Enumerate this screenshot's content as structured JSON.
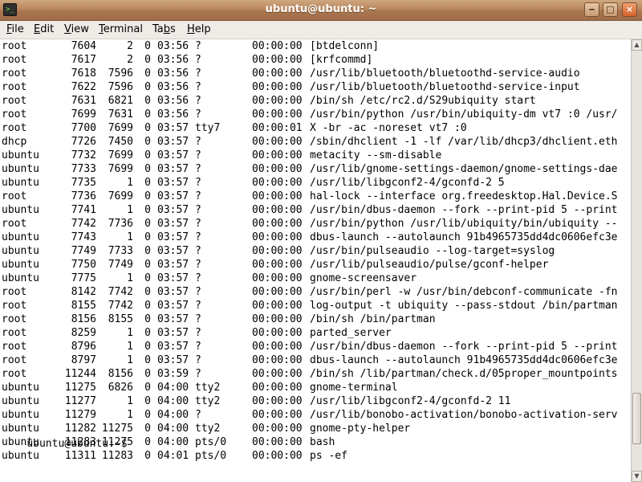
{
  "window": {
    "title": "ubuntu@ubuntu: ~",
    "buttons": {
      "minimize": "‒",
      "maximize": "□",
      "close": "×"
    }
  },
  "menu": [
    {
      "label": "File",
      "mnemonic": "F",
      "rest": "ile"
    },
    {
      "label": "Edit",
      "mnemonic": "E",
      "rest": "dit"
    },
    {
      "label": "View",
      "mnemonic": "V",
      "rest": "iew"
    },
    {
      "label": "Terminal",
      "mnemonic": "T",
      "rest": "erminal"
    },
    {
      "label": "Tabs",
      "mnemonic": "b",
      "pre": "Ta",
      "rest": "s"
    },
    {
      "label": "Help",
      "mnemonic": "H",
      "rest": "elp"
    }
  ],
  "terminal": {
    "rows": [
      {
        "user": "root",
        "pid": "7604",
        "ppid": "2",
        "c": "0",
        "stime": "03:56",
        "tty": "?",
        "time": "00:00:00",
        "cmd": "[btdelconn]"
      },
      {
        "user": "root",
        "pid": "7617",
        "ppid": "2",
        "c": "0",
        "stime": "03:56",
        "tty": "?",
        "time": "00:00:00",
        "cmd": "[krfcommd]"
      },
      {
        "user": "root",
        "pid": "7618",
        "ppid": "7596",
        "c": "0",
        "stime": "03:56",
        "tty": "?",
        "time": "00:00:00",
        "cmd": "/usr/lib/bluetooth/bluetoothd-service-audio"
      },
      {
        "user": "root",
        "pid": "7622",
        "ppid": "7596",
        "c": "0",
        "stime": "03:56",
        "tty": "?",
        "time": "00:00:00",
        "cmd": "/usr/lib/bluetooth/bluetoothd-service-input"
      },
      {
        "user": "root",
        "pid": "7631",
        "ppid": "6821",
        "c": "0",
        "stime": "03:56",
        "tty": "?",
        "time": "00:00:00",
        "cmd": "/bin/sh /etc/rc2.d/S29ubiquity start"
      },
      {
        "user": "root",
        "pid": "7699",
        "ppid": "7631",
        "c": "0",
        "stime": "03:56",
        "tty": "?",
        "time": "00:00:00",
        "cmd": "/usr/bin/python /usr/bin/ubiquity-dm vt7 :0 /usr/"
      },
      {
        "user": "root",
        "pid": "7700",
        "ppid": "7699",
        "c": "0",
        "stime": "03:57",
        "tty": "tty7",
        "time": "00:00:01",
        "cmd": "X -br -ac -noreset vt7 :0"
      },
      {
        "user": "dhcp",
        "pid": "7726",
        "ppid": "7450",
        "c": "0",
        "stime": "03:57",
        "tty": "?",
        "time": "00:00:00",
        "cmd": "/sbin/dhclient -1 -lf /var/lib/dhcp3/dhclient.eth"
      },
      {
        "user": "ubuntu",
        "pid": "7732",
        "ppid": "7699",
        "c": "0",
        "stime": "03:57",
        "tty": "?",
        "time": "00:00:00",
        "cmd": "metacity --sm-disable"
      },
      {
        "user": "ubuntu",
        "pid": "7733",
        "ppid": "7699",
        "c": "0",
        "stime": "03:57",
        "tty": "?",
        "time": "00:00:00",
        "cmd": "/usr/lib/gnome-settings-daemon/gnome-settings-dae"
      },
      {
        "user": "ubuntu",
        "pid": "7735",
        "ppid": "1",
        "c": "0",
        "stime": "03:57",
        "tty": "?",
        "time": "00:00:00",
        "cmd": "/usr/lib/libgconf2-4/gconfd-2 5"
      },
      {
        "user": "root",
        "pid": "7736",
        "ppid": "7699",
        "c": "0",
        "stime": "03:57",
        "tty": "?",
        "time": "00:00:00",
        "cmd": "hal-lock --interface org.freedesktop.Hal.Device.S"
      },
      {
        "user": "ubuntu",
        "pid": "7741",
        "ppid": "1",
        "c": "0",
        "stime": "03:57",
        "tty": "?",
        "time": "00:00:00",
        "cmd": "/usr/bin/dbus-daemon --fork --print-pid 5 --print"
      },
      {
        "user": "root",
        "pid": "7742",
        "ppid": "7736",
        "c": "0",
        "stime": "03:57",
        "tty": "?",
        "time": "00:00:00",
        "cmd": "/usr/bin/python /usr/lib/ubiquity/bin/ubiquity --"
      },
      {
        "user": "ubuntu",
        "pid": "7743",
        "ppid": "1",
        "c": "0",
        "stime": "03:57",
        "tty": "?",
        "time": "00:00:00",
        "cmd": "dbus-launch --autolaunch 91b4965735dd4dc0606efc3e"
      },
      {
        "user": "ubuntu",
        "pid": "7749",
        "ppid": "7733",
        "c": "0",
        "stime": "03:57",
        "tty": "?",
        "time": "00:00:00",
        "cmd": "/usr/bin/pulseaudio --log-target=syslog"
      },
      {
        "user": "ubuntu",
        "pid": "7750",
        "ppid": "7749",
        "c": "0",
        "stime": "03:57",
        "tty": "?",
        "time": "00:00:00",
        "cmd": "/usr/lib/pulseaudio/pulse/gconf-helper"
      },
      {
        "user": "ubuntu",
        "pid": "7775",
        "ppid": "1",
        "c": "0",
        "stime": "03:57",
        "tty": "?",
        "time": "00:00:00",
        "cmd": "gnome-screensaver"
      },
      {
        "user": "root",
        "pid": "8142",
        "ppid": "7742",
        "c": "0",
        "stime": "03:57",
        "tty": "?",
        "time": "00:00:00",
        "cmd": "/usr/bin/perl -w /usr/bin/debconf-communicate -fn"
      },
      {
        "user": "root",
        "pid": "8155",
        "ppid": "7742",
        "c": "0",
        "stime": "03:57",
        "tty": "?",
        "time": "00:00:00",
        "cmd": "log-output -t ubiquity --pass-stdout /bin/partman"
      },
      {
        "user": "root",
        "pid": "8156",
        "ppid": "8155",
        "c": "0",
        "stime": "03:57",
        "tty": "?",
        "time": "00:00:00",
        "cmd": "/bin/sh /bin/partman"
      },
      {
        "user": "root",
        "pid": "8259",
        "ppid": "1",
        "c": "0",
        "stime": "03:57",
        "tty": "?",
        "time": "00:00:00",
        "cmd": "parted_server"
      },
      {
        "user": "root",
        "pid": "8796",
        "ppid": "1",
        "c": "0",
        "stime": "03:57",
        "tty": "?",
        "time": "00:00:00",
        "cmd": "/usr/bin/dbus-daemon --fork --print-pid 5 --print"
      },
      {
        "user": "root",
        "pid": "8797",
        "ppid": "1",
        "c": "0",
        "stime": "03:57",
        "tty": "?",
        "time": "00:00:00",
        "cmd": "dbus-launch --autolaunch 91b4965735dd4dc0606efc3e"
      },
      {
        "user": "root",
        "pid": "11244",
        "ppid": "8156",
        "c": "0",
        "stime": "03:59",
        "tty": "?",
        "time": "00:00:00",
        "cmd": "/bin/sh /lib/partman/check.d/05proper_mountpoints"
      },
      {
        "user": "ubuntu",
        "pid": "11275",
        "ppid": "6826",
        "c": "0",
        "stime": "04:00",
        "tty": "tty2",
        "time": "00:00:00",
        "cmd": "gnome-terminal"
      },
      {
        "user": "ubuntu",
        "pid": "11277",
        "ppid": "1",
        "c": "0",
        "stime": "04:00",
        "tty": "tty2",
        "time": "00:00:00",
        "cmd": "/usr/lib/libgconf2-4/gconfd-2 11"
      },
      {
        "user": "ubuntu",
        "pid": "11279",
        "ppid": "1",
        "c": "0",
        "stime": "04:00",
        "tty": "?",
        "time": "00:00:00",
        "cmd": "/usr/lib/bonobo-activation/bonobo-activation-serv"
      },
      {
        "user": "ubuntu",
        "pid": "11282",
        "ppid": "11275",
        "c": "0",
        "stime": "04:00",
        "tty": "tty2",
        "time": "00:00:00",
        "cmd": "gnome-pty-helper"
      },
      {
        "user": "ubuntu",
        "pid": "11283",
        "ppid": "11275",
        "c": "0",
        "stime": "04:00",
        "tty": "pts/0",
        "time": "00:00:00",
        "cmd": "bash"
      },
      {
        "user": "ubuntu",
        "pid": "11311",
        "ppid": "11283",
        "c": "0",
        "stime": "04:01",
        "tty": "pts/0",
        "time": "00:00:00",
        "cmd": "ps -ef"
      }
    ],
    "prompt": "ubuntu@ubuntu:~$"
  }
}
